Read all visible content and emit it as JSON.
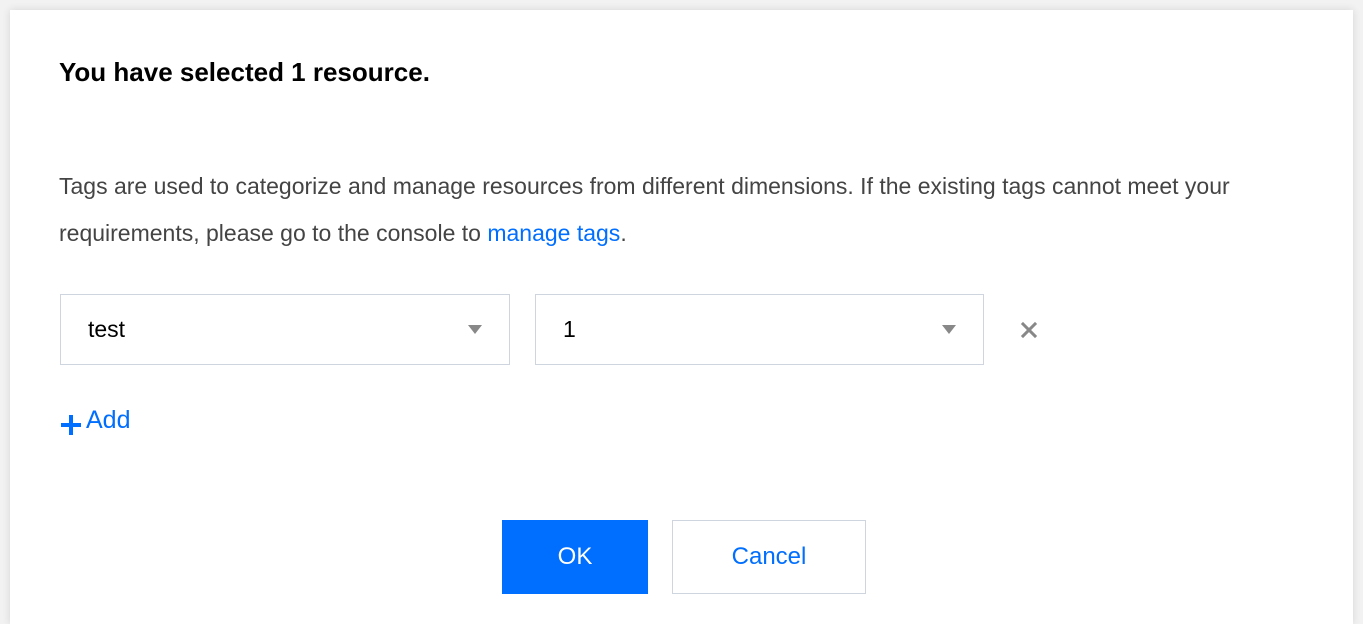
{
  "dialog": {
    "title": "You have selected 1 resource.",
    "description_before_link": "Tags are used to categorize and manage resources from different dimensions. If the existing tags cannot meet your requirements, please go to the console to ",
    "link_text": "manage tags",
    "description_after_link": "."
  },
  "tag_row": {
    "key_value": "test",
    "value_value": "1",
    "key_icon": "chevron-down-icon",
    "value_icon": "chevron-down-icon",
    "remove_icon": "close-icon"
  },
  "add": {
    "icon": "plus-icon",
    "label": "Add"
  },
  "buttons": {
    "ok_label": "OK",
    "cancel_label": "Cancel"
  },
  "colors": {
    "accent": "#006eff",
    "text": "#444444",
    "title": "#000000",
    "border": "#cfd5de",
    "icon": "#888888"
  }
}
